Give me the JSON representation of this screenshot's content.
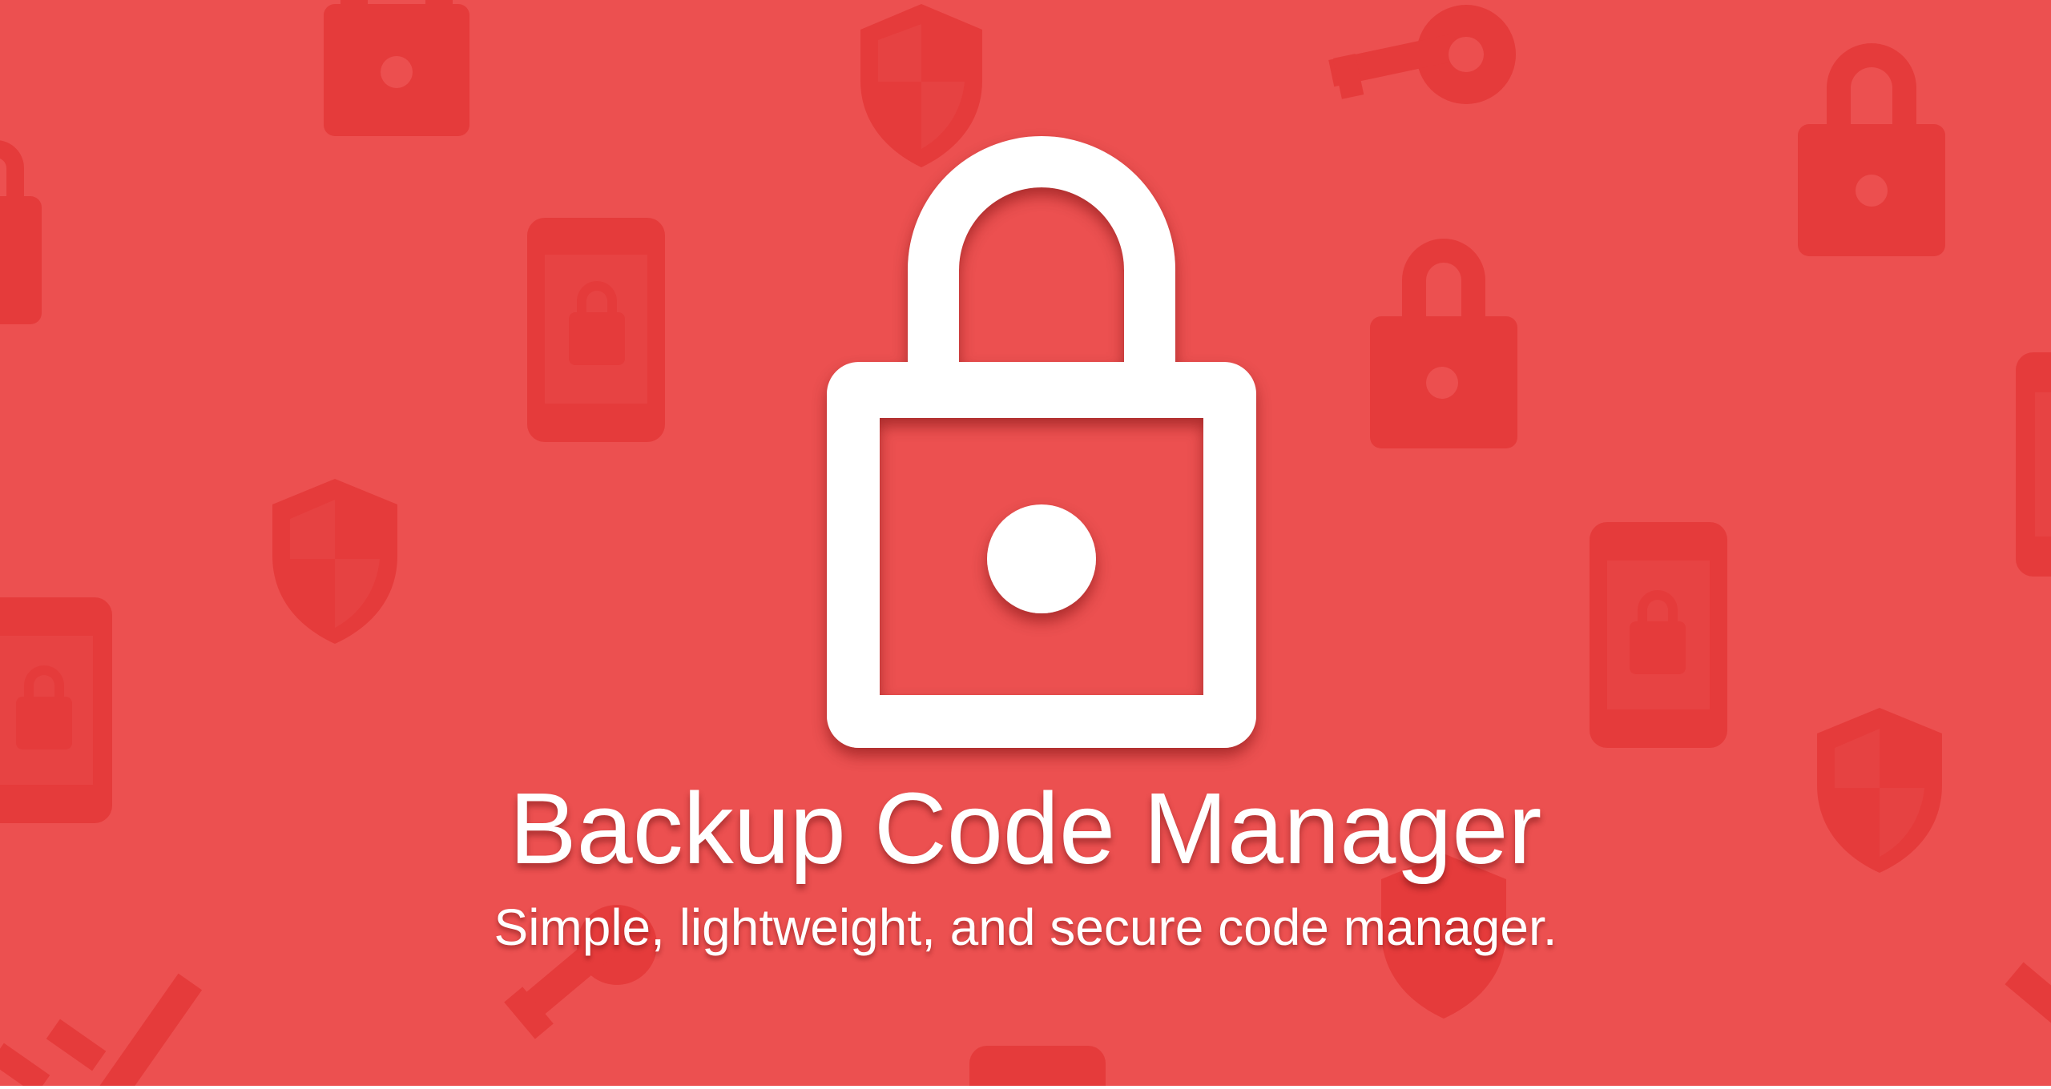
{
  "banner": {
    "title": "Backup Code Manager",
    "tagline": "Simple, lightweight, and secure code manager.",
    "hero_icon": "padlock-icon",
    "background_icons": [
      "padlock-icon",
      "shield-icon",
      "key-icon",
      "phone-lock-icon"
    ]
  },
  "colors": {
    "background": "#ec5050",
    "pattern_icon": "#e43838",
    "foreground": "#ffffff"
  }
}
